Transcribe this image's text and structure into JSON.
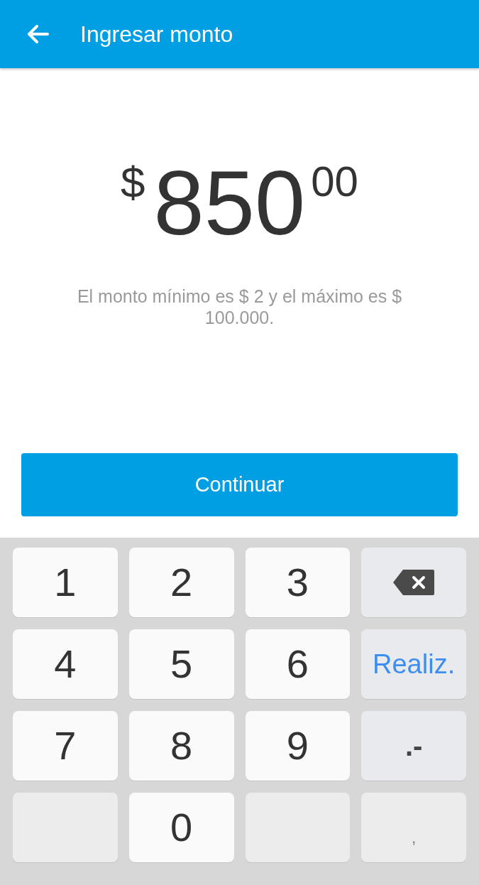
{
  "header": {
    "title": "Ingresar monto"
  },
  "amount": {
    "currency": "$",
    "whole": "850",
    "cents": "00"
  },
  "note": "El monto mínimo es $ 2 y el máximo es $ 100.000.",
  "continue_button": {
    "label": "Continuar"
  },
  "keypad": [
    {
      "kind": "digit",
      "label": "1"
    },
    {
      "kind": "digit",
      "label": "2"
    },
    {
      "kind": "digit",
      "label": "3"
    },
    {
      "kind": "backspace"
    },
    {
      "kind": "digit",
      "label": "4"
    },
    {
      "kind": "digit",
      "label": "5"
    },
    {
      "kind": "digit",
      "label": "6"
    },
    {
      "kind": "done",
      "label": "Realiz."
    },
    {
      "kind": "digit",
      "label": "7"
    },
    {
      "kind": "digit",
      "label": "8"
    },
    {
      "kind": "digit",
      "label": "9"
    },
    {
      "kind": "symbol",
      "label": ".-",
      "disabled": false
    },
    {
      "kind": "blank"
    },
    {
      "kind": "digit",
      "label": "0"
    },
    {
      "kind": "blank"
    },
    {
      "kind": "symbol",
      "label": ",",
      "disabled": true
    }
  ]
}
